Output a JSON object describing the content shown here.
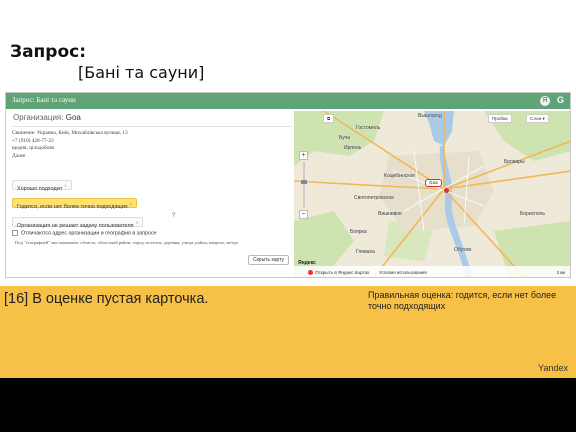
{
  "slide": {
    "title": "Запрос:",
    "query": "[Бані та сауни]"
  },
  "panel": {
    "header_text": "Запрос: Бані та сауни",
    "header_icons": [
      "yandex-ya-icon",
      "google-g-icon"
    ],
    "org_title_label": "Организация:",
    "org_title_value": "Goa",
    "org_lines": [
      "Свинение: Украина, Київ, Михайлівська вулиця, 13",
      "+7 (910) 428-77-22",
      "щодня, цілодобово",
      "Далее"
    ],
    "answers": [
      {
        "label": "Хорошо подходит",
        "key": "1"
      },
      {
        "label": "Годится, если нет более точно подходящих",
        "key": "2"
      },
      {
        "label": "Организация не решает задачу пользователя",
        "key": "3"
      }
    ],
    "q_mark": "?",
    "checkbox_label": "Отличаются адрес организации и география в запросе",
    "checkbox_hint": "Под \"географией\" мы понимаем: область, областной район, город, посёлок, деревня, улица, район, квартал, метро",
    "hide_map_label": "Скрыть карту"
  },
  "map": {
    "controls": {
      "layers_icon": "layers-icon",
      "traffic": "Пробки",
      "layer_select": "Слои ▾"
    },
    "pin_label": "Goa",
    "labels": [
      {
        "text": "Вышгород",
        "pos": "a"
      },
      {
        "text": "Гостомель",
        "pos": "b"
      },
      {
        "text": "Буча",
        "pos": "c"
      },
      {
        "text": "Ирпень",
        "pos": "d"
      },
      {
        "text": "Бровары",
        "pos": "e"
      },
      {
        "text": "Святопетровское",
        "pos": "f"
      },
      {
        "text": "Вишневое",
        "pos": "g"
      },
      {
        "text": "Боярка",
        "pos": "h"
      },
      {
        "text": "Глеваха",
        "pos": "i"
      },
      {
        "text": "Обухов",
        "pos": "j"
      },
      {
        "text": "Коцюбинское",
        "pos": "k"
      },
      {
        "text": "Борисполь",
        "pos": "l"
      }
    ],
    "open_link": "Открыть в Яндекс.Картах",
    "terms": "Условия использования",
    "brand": "Яндекс",
    "scale": "3 км"
  },
  "note": {
    "left": "[16] В оценке пустая карточка.",
    "right": "Правильная оценка: годится, если нет более точно подходящих",
    "brand": "Yandex"
  },
  "colors": {
    "header_green": "#5fa376",
    "note_orange": "#f7c046",
    "selected_answer": "#ffe171"
  }
}
